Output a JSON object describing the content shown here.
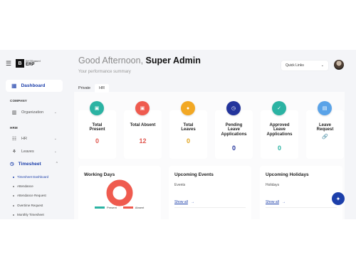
{
  "sidebar": {
    "brand_top": "BYTEgaurd",
    "brand_bottom": "ERP",
    "dashboard": "Dashboard",
    "section_company": "COMPANY",
    "organization": "Organization",
    "section_hrm": "HRM",
    "hr": "HR",
    "leaves": "Leaves",
    "timesheet": "Timesheet",
    "timesheet_items": [
      "Timesheet Dashboard",
      "Attendance",
      "Attendance Request",
      "Overtime Request",
      "Monthly Timesheet"
    ]
  },
  "header": {
    "greeting": "Good Afternoon,",
    "user": "Super Admin",
    "subtitle": "Your performance summary",
    "quick_links": "Quick Links"
  },
  "tabs": [
    "Private",
    "HR"
  ],
  "cards": [
    {
      "label": "Total Present",
      "value": "0",
      "color": "#2bb3a3",
      "value_color": "#e0574f"
    },
    {
      "label": "Total Absent",
      "value": "12",
      "color": "#ef5b4f",
      "value_color": "#e0574f"
    },
    {
      "label": "Total Leaves",
      "value": "0",
      "color": "#f2a824",
      "value_color": "#e0a41f"
    },
    {
      "label": "Pending Leave Applications",
      "value": "0",
      "color": "#23349c",
      "value_color": "#23349c"
    },
    {
      "label": "Approved Leave Applications",
      "value": "0",
      "color": "#2bb3a3",
      "value_color": "#2bb3a3"
    },
    {
      "label": "Leave Request",
      "value": "🔗",
      "color": "#5aa3e8",
      "value_color": "#3f86d9"
    }
  ],
  "working_days": {
    "title": "Working Days",
    "legend": [
      {
        "label": "Present",
        "color": "#2bb3a3"
      },
      {
        "label": "Absent",
        "color": "#ef5b4f"
      }
    ]
  },
  "events": {
    "title": "Upcoming Events",
    "sub": "Events",
    "show_all": "Show all"
  },
  "holidays": {
    "title": "Upcoming Holidays",
    "sub": "Holidays",
    "show_all": "Show all"
  }
}
